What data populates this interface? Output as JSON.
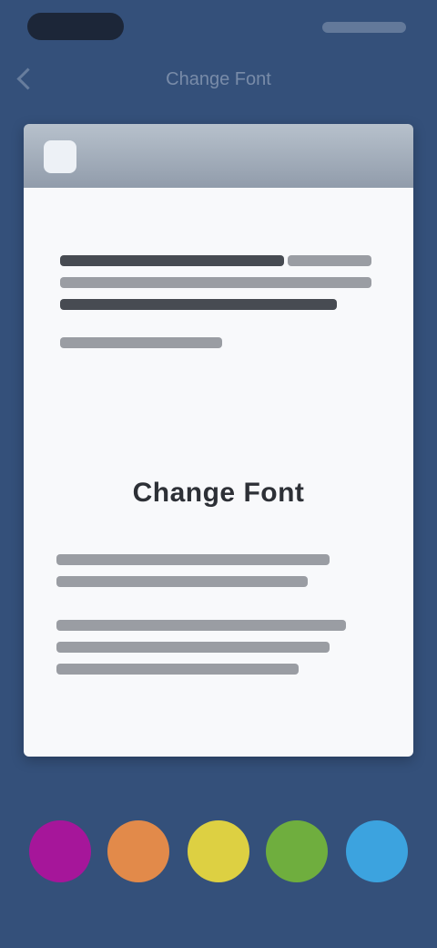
{
  "nav": {
    "title": "Change Font"
  },
  "card": {
    "heading": "Change Font"
  },
  "swatches": [
    {
      "name": "magenta",
      "color": "#a6169a"
    },
    {
      "name": "orange",
      "color": "#e28a4a"
    },
    {
      "name": "yellow",
      "color": "#ddd042"
    },
    {
      "name": "green",
      "color": "#6fae3e"
    },
    {
      "name": "blue",
      "color": "#3ca3df"
    }
  ],
  "colors": {
    "background": "#34507a",
    "card": "#f8f9fb",
    "card_header": "#a5afbc"
  }
}
